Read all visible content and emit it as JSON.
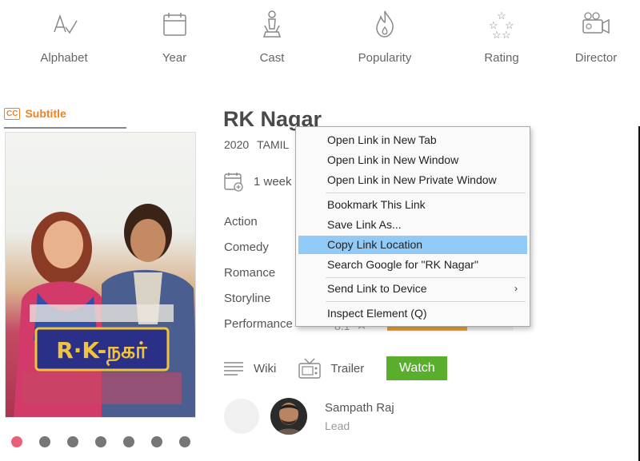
{
  "nav": {
    "items": [
      {
        "label": "Alphabet",
        "icon": "alphabet-icon"
      },
      {
        "label": "Year",
        "icon": "calendar-icon"
      },
      {
        "label": "Cast",
        "icon": "cast-icon"
      },
      {
        "label": "Popularity",
        "icon": "flame-icon"
      },
      {
        "label": "Rating",
        "icon": "stars-icon"
      },
      {
        "label": "Director",
        "icon": "camera-icon"
      }
    ]
  },
  "subtitle_tab": {
    "badge": "CC",
    "label": "Subtitle"
  },
  "poster": {
    "title_art": "R·K-நகர்",
    "dots_count": 7,
    "active_dot": 0
  },
  "movie": {
    "title": "RK Nagar",
    "year": "2020",
    "language": "TAMIL",
    "release": "1 week",
    "genres": [
      "Action",
      "Comedy",
      "Romance",
      "Storyline",
      "Performance"
    ],
    "performance_score": "8.1",
    "performance_fill": 0.63
  },
  "actions": {
    "wiki": "Wiki",
    "trailer": "Trailer",
    "watch": "Watch"
  },
  "cast": [
    {
      "name": "Sampath Raj",
      "role": "Lead"
    }
  ],
  "context_menu": {
    "items": [
      "Open Link in New Tab",
      "Open Link in New Window",
      "Open Link in New Private Window",
      "Bookmark This Link",
      "Save Link As...",
      "Copy Link Location",
      "Search Google for \"RK Nagar\"",
      "Send Link to Device",
      "Inspect Element (Q)"
    ],
    "highlighted": "Copy Link Location",
    "submenu_arrow": "›"
  },
  "colors": {
    "accent": "#e8832a",
    "watch": "#5aae2e",
    "highlight": "#91c9f7",
    "rating_bar": "#f0a030"
  }
}
